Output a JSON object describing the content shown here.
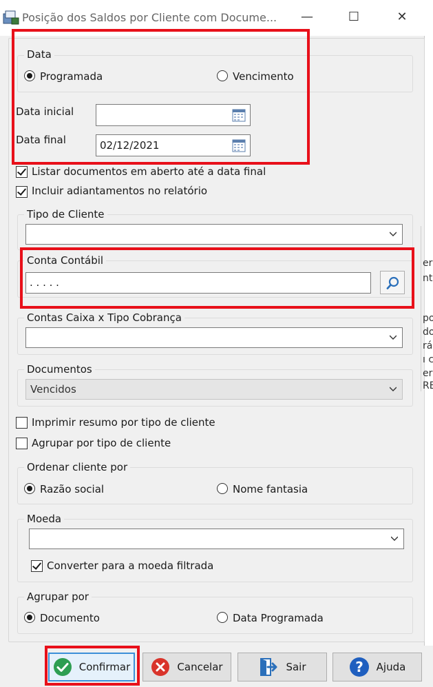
{
  "window": {
    "title": "Posição dos Saldos por Cliente com Docume...",
    "minimize_glyph": "—",
    "maximize_glyph": "☐",
    "close_glyph": "✕"
  },
  "data_group": {
    "title": "Data",
    "option_programada": "Programada",
    "option_vencimento": "Vencimento",
    "selected": "Programada",
    "data_inicial_label": "Data inicial",
    "data_inicial_value": "",
    "data_final_label": "Data final",
    "data_final_value": "02/12/2021"
  },
  "checks": {
    "listar_docs": {
      "label": "Listar documentos em aberto até a data final",
      "checked": true
    },
    "incluir_adiant": {
      "label": "Incluir adiantamentos no relatório",
      "checked": true
    },
    "imprimir_resumo": {
      "label": "Imprimir resumo por tipo de cliente",
      "checked": false
    },
    "agrupar_tipo": {
      "label": "Agrupar por tipo de cliente",
      "checked": false
    },
    "converter_moeda": {
      "label": "Converter para a moeda filtrada",
      "checked": true
    }
  },
  "tipo_cliente": {
    "title": "Tipo de Cliente",
    "value": ""
  },
  "conta_contabil": {
    "title": "Conta Contábil",
    "value": ". . . . ."
  },
  "contas_caixa": {
    "title": "Contas Caixa x Tipo Cobrança",
    "value": ""
  },
  "documentos": {
    "title": "Documentos",
    "value": "Vencidos"
  },
  "ordenar": {
    "title": "Ordenar cliente por",
    "option_razao": "Razão social",
    "option_fantasia": "Nome fantasia",
    "selected": "Razão social"
  },
  "moeda": {
    "title": "Moeda",
    "value": ""
  },
  "agrupar": {
    "title": "Agrupar por",
    "option_documento": "Documento",
    "option_data_programada": "Data Programada",
    "selected": "Documento"
  },
  "buttons": {
    "confirmar": "Confirmar",
    "cancelar": "Cancelar",
    "sair": "Sair",
    "ajuda": "Ajuda"
  },
  "background_fragments": [
    "er",
    "nt",
    "po",
    "do",
    "rá",
    "ı c",
    "cı",
    "er",
    "RE"
  ],
  "colors": {
    "highlight": "#e8101a",
    "confirm_green": "#2e9e52",
    "cancel_red": "#d9342b",
    "help_blue": "#1f5fbf",
    "exit_blue": "#2a6fba"
  }
}
